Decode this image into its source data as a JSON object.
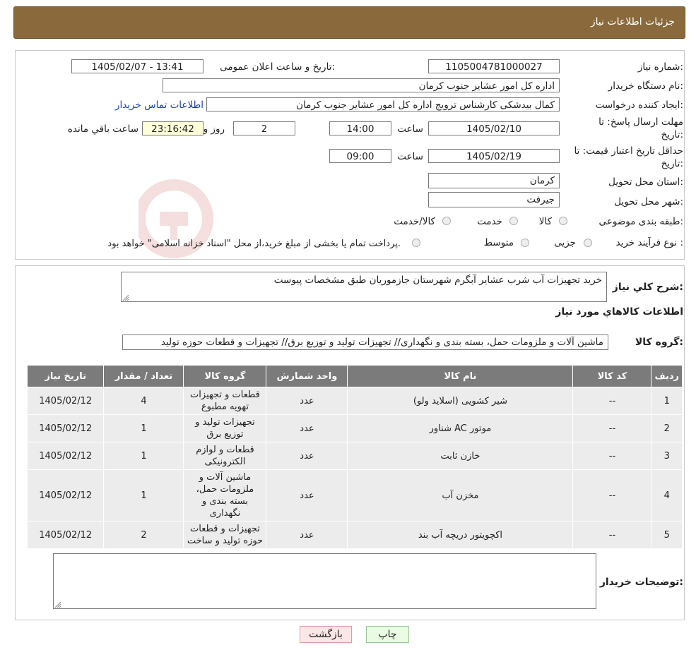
{
  "header": {
    "title": "جزئیات اطلاعات نیاز"
  },
  "need_number": {
    "label": "شماره نیاز:",
    "value": "1105004781000027"
  },
  "announce": {
    "label": "تاریخ و ساعت اعلان عمومی:",
    "value": "1405/02/07 - 13:41"
  },
  "buyer_org": {
    "label": "نام دستگاه خریدار:",
    "value": "اداره کل امور عشایر جنوب کرمان"
  },
  "creator": {
    "label": "ایجاد کننده درخواست:",
    "value": "کمال بیدشکی کارشناس ترویج اداره کل امور عشایر جنوب کرمان",
    "contact_link": "اطلاعات تماس خریدار"
  },
  "deadline": {
    "label_line1": "مهلت ارسال پاسخ: تا",
    "label_line2": "تاریخ:",
    "date": "1405/02/10",
    "time_label": "ساعت",
    "time": "14:00",
    "days": "2",
    "days_label": "روز و",
    "remaining": "23:16:42",
    "remaining_label": "ساعت باقي مانده"
  },
  "validity": {
    "label_line1": "حداقل تاریخ اعتبار قیمت: تا",
    "label_line2": "تاریخ:",
    "date": "1405/02/19",
    "time_label": "ساعت",
    "time": "09:00"
  },
  "province": {
    "label": "استان محل تحویل:",
    "value": "کرمان"
  },
  "city": {
    "label": "شهر محل تحویل:",
    "value": "جیرفت"
  },
  "category": {
    "label": "طبقه بندی موضوعی:",
    "options": [
      "کالا",
      "خدمت",
      "کالا/خدمت"
    ]
  },
  "process": {
    "label": "نوع فرآیند خرید :",
    "options": [
      "جزیی",
      "متوسط"
    ],
    "note": "پرداخت تمام یا بخشی از مبلغ خرید،از محل \"اسناد خزانه اسلامی\" خواهد بود."
  },
  "summary": {
    "label": "شرح کلي نياز:",
    "value": "خرید تجهیزات آب شرب عشایر آبگرم شهرستان جازموریان طبق مشخصات پیوست"
  },
  "goods_title": "اطلاعات کالاهاي مورد نياز",
  "goods_group": {
    "label": "گروه کالا:",
    "value": "ماشین آلات و ملزومات حمل، بسته بندی و نگهداری// تجهیزات تولید و توزیع برق// تجهیزات و قطعات حوزه تولید"
  },
  "table": {
    "headers": [
      "رديف",
      "کد کالا",
      "نام کالا",
      "واحد شمارش",
      "گروه کالا",
      "تعداد / مقدار",
      "تاریخ نیاز"
    ],
    "rows": [
      [
        "1",
        "--",
        "شیر کشویی (اسلاید ولو)",
        "عدد",
        "قطعات و تجهیزات تهویه مطبوع",
        "4",
        "1405/02/12"
      ],
      [
        "2",
        "--",
        "موتور AC شناور",
        "عدد",
        "تجهیزات تولید و توزیع برق",
        "1",
        "1405/02/12"
      ],
      [
        "3",
        "--",
        "خازن ثابت",
        "عدد",
        "قطعات و لوازم الکترونیکی",
        "1",
        "1405/02/12"
      ],
      [
        "4",
        "--",
        "مخزن آب",
        "عدد",
        "ماشین آلات و ملزومات حمل، بسته بندی و نگهداری",
        "1",
        "1405/02/12"
      ],
      [
        "5",
        "--",
        "اکچویتور دریچه آب بند",
        "عدد",
        "تجهیزات و قطعات حوزه تولید و ساخت",
        "2",
        "1405/02/12"
      ]
    ]
  },
  "buyer_notes": {
    "label": "توضیحات خریدار:",
    "value": ""
  },
  "buttons": {
    "print": "چاپ",
    "back": "بازگشت"
  },
  "colors": {
    "header_bg": "#8a6a3c",
    "table_header_bg": "#7b7b7b",
    "back_button_bg": "#fde6e6",
    "print_button_bg": "#eafbe4"
  }
}
